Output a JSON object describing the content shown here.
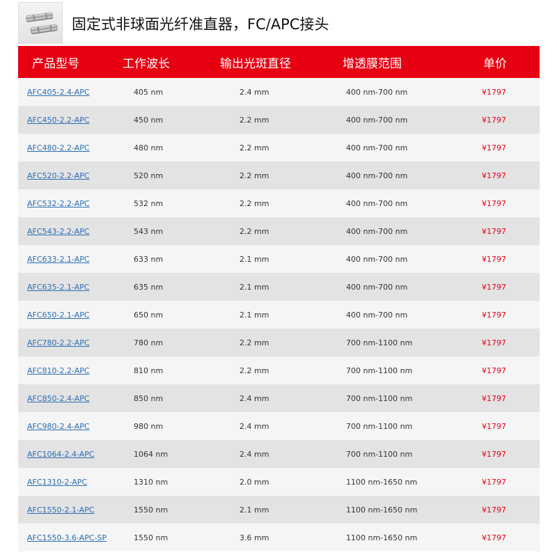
{
  "header": {
    "title": "固定式非球面光纤准直器，FC/APC接头",
    "thumbnail_icon": "collimator-product-image"
  },
  "table": {
    "columns": [
      "产品型号",
      "工作波长",
      "输出光斑直径",
      "增透膜范围",
      "单价"
    ],
    "rows": [
      {
        "model": "AFC405-2.4-APC",
        "wavelength": "405 nm",
        "spot": "2.4 mm",
        "coating": "400 nm-700 nm",
        "price": "¥1797"
      },
      {
        "model": "AFC450-2.2-APC",
        "wavelength": "450 nm",
        "spot": "2.2 mm",
        "coating": "400 nm-700 nm",
        "price": "¥1797"
      },
      {
        "model": "AFC480-2.2-APC",
        "wavelength": "480 nm",
        "spot": "2.2 mm",
        "coating": "400 nm-700 nm",
        "price": "¥1797"
      },
      {
        "model": "AFC520-2.2-APC",
        "wavelength": "520 nm",
        "spot": "2.2 mm",
        "coating": "400 nm-700 nm",
        "price": "¥1797"
      },
      {
        "model": "AFC532-2.2-APC",
        "wavelength": "532 nm",
        "spot": "2.2 mm",
        "coating": "400 nm-700 nm",
        "price": "¥1797"
      },
      {
        "model": "AFC543-2.2-APC",
        "wavelength": "543 nm",
        "spot": "2.2 mm",
        "coating": "400 nm-700 nm",
        "price": "¥1797"
      },
      {
        "model": "AFC633-2.1-APC",
        "wavelength": "633 nm",
        "spot": "2.1 mm",
        "coating": "400 nm-700 nm",
        "price": "¥1797"
      },
      {
        "model": "AFC635-2.1-APC",
        "wavelength": "635 nm",
        "spot": "2.1 mm",
        "coating": "400 nm-700 nm",
        "price": "¥1797"
      },
      {
        "model": "AFC650-2.1-APC",
        "wavelength": "650 nm",
        "spot": "2.1 mm",
        "coating": "400 nm-700 nm",
        "price": "¥1797"
      },
      {
        "model": "AFC780-2.2-APC",
        "wavelength": "780 nm",
        "spot": "2.2 mm",
        "coating": "700 nm-1100 nm",
        "price": "¥1797"
      },
      {
        "model": "AFC810-2.2-APC",
        "wavelength": "810 nm",
        "spot": "2.2 mm",
        "coating": "700 nm-1100 nm",
        "price": "¥1797"
      },
      {
        "model": "AFC850-2.4-APC",
        "wavelength": "850 nm",
        "spot": "2.4 mm",
        "coating": "700 nm-1100 nm",
        "price": "¥1797"
      },
      {
        "model": "AFC980-2.4-APC",
        "wavelength": "980 nm",
        "spot": "2.4 mm",
        "coating": "700 nm-1100 nm",
        "price": "¥1797"
      },
      {
        "model": "AFC1064-2.4-APC",
        "wavelength": "1064 nm",
        "spot": "2.4 mm",
        "coating": "700 nm-1100 nm",
        "price": "¥1797"
      },
      {
        "model": "AFC1310-2-APC",
        "wavelength": "1310 nm",
        "spot": "2.0 mm",
        "coating": "1100 nm-1650 nm",
        "price": "¥1797"
      },
      {
        "model": "AFC1550-2.1-APC",
        "wavelength": "1550 nm",
        "spot": "2.1 mm",
        "coating": "1100 nm-1650 nm",
        "price": "¥1797"
      },
      {
        "model": "AFC1550-3.6-APC-SP",
        "wavelength": "1550 nm",
        "spot": "3.6 mm",
        "coating": "1100 nm-1650 nm",
        "price": "¥1797"
      }
    ]
  },
  "colors": {
    "header_red": "#e60012",
    "link_blue": "#2a6db5",
    "price_red": "#e60012",
    "row_light": "#f5f5f5",
    "row_dark": "#e3e3e3"
  }
}
